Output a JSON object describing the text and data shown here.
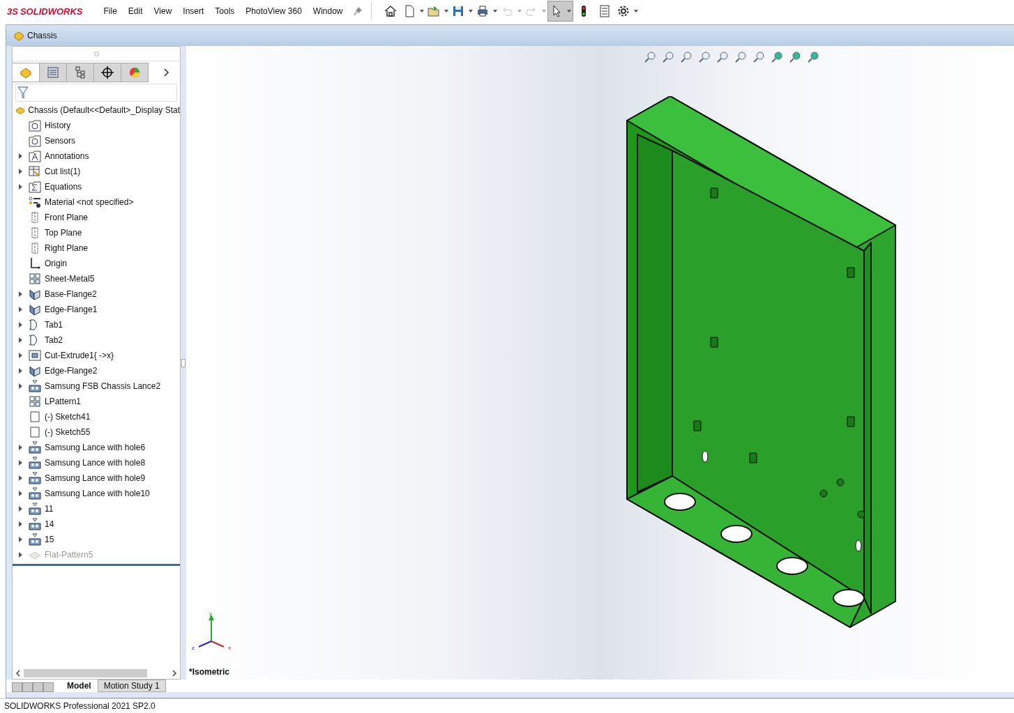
{
  "app": {
    "logo_mark": "3S",
    "logo_text": "SOLIDWORKS"
  },
  "menu": [
    "File",
    "Edit",
    "View",
    "Insert",
    "Tools",
    "PhotoView 360",
    "Window"
  ],
  "toolbar": [
    {
      "kind": "home",
      "dropdown": false,
      "selected": false,
      "disabled": false
    },
    {
      "kind": "new",
      "dropdown": true,
      "selected": false,
      "disabled": false
    },
    {
      "kind": "open",
      "dropdown": true,
      "selected": false,
      "disabled": false
    },
    {
      "kind": "save",
      "dropdown": true,
      "selected": false,
      "disabled": false
    },
    {
      "kind": "print",
      "dropdown": true,
      "selected": false,
      "disabled": false
    },
    {
      "kind": "undo",
      "dropdown": true,
      "selected": false,
      "disabled": true
    },
    {
      "kind": "redo",
      "dropdown": true,
      "selected": false,
      "disabled": true
    },
    {
      "kind": "select",
      "dropdown": true,
      "selected": true,
      "disabled": false
    },
    {
      "kind": "traffic",
      "dropdown": false,
      "selected": false,
      "disabled": false
    },
    {
      "kind": "options",
      "dropdown": false,
      "selected": false,
      "disabled": false
    },
    {
      "kind": "gear",
      "dropdown": true,
      "selected": false,
      "disabled": false
    }
  ],
  "document": {
    "title": "Chassis"
  },
  "panel_tabs": [
    {
      "kind": "feature",
      "selected": true
    },
    {
      "kind": "property",
      "selected": false
    },
    {
      "kind": "config",
      "selected": false
    },
    {
      "kind": "dim",
      "selected": false
    },
    {
      "kind": "display",
      "selected": false
    }
  ],
  "tree_root": "Chassis  (Default<<Default>_Display Stat",
  "tree": [
    {
      "label": "History",
      "kind": "history",
      "expandable": false,
      "suppressed": false
    },
    {
      "label": "Sensors",
      "kind": "sensors",
      "expandable": false,
      "suppressed": false
    },
    {
      "label": "Annotations",
      "kind": "annotations",
      "expandable": true,
      "suppressed": false
    },
    {
      "label": "Cut list(1)",
      "kind": "cutlist",
      "expandable": true,
      "suppressed": false
    },
    {
      "label": "Equations",
      "kind": "equations",
      "expandable": true,
      "suppressed": false
    },
    {
      "label": "Material <not specified>",
      "kind": "material",
      "expandable": false,
      "suppressed": false
    },
    {
      "label": "Front Plane",
      "kind": "plane",
      "expandable": false,
      "suppressed": false
    },
    {
      "label": "Top Plane",
      "kind": "plane",
      "expandable": false,
      "suppressed": false
    },
    {
      "label": "Right Plane",
      "kind": "plane",
      "expandable": false,
      "suppressed": false
    },
    {
      "label": "Origin",
      "kind": "origin",
      "expandable": false,
      "suppressed": false
    },
    {
      "label": "Sheet-Metal5",
      "kind": "sheetmetal",
      "expandable": false,
      "suppressed": false
    },
    {
      "label": "Base-Flange2",
      "kind": "flange",
      "expandable": true,
      "suppressed": false
    },
    {
      "label": "Edge-Flange1",
      "kind": "flange",
      "expandable": true,
      "suppressed": false
    },
    {
      "label": "Tab1",
      "kind": "tab",
      "expandable": true,
      "suppressed": false
    },
    {
      "label": "Tab2",
      "kind": "tab",
      "expandable": true,
      "suppressed": false
    },
    {
      "label": "Cut-Extrude1{ ->x}",
      "kind": "cut",
      "expandable": true,
      "suppressed": false
    },
    {
      "label": "Edge-Flange2",
      "kind": "flange",
      "expandable": true,
      "suppressed": false
    },
    {
      "label": "Samsung FSB Chassis Lance2",
      "kind": "lance",
      "expandable": true,
      "suppressed": false
    },
    {
      "label": "LPattern1",
      "kind": "pattern",
      "expandable": false,
      "suppressed": false
    },
    {
      "label": "(-) Sketch41",
      "kind": "sketch",
      "expandable": false,
      "suppressed": false
    },
    {
      "label": "(-) Sketch55",
      "kind": "sketch",
      "expandable": false,
      "suppressed": false
    },
    {
      "label": "Samsung Lance with hole6",
      "kind": "lance",
      "expandable": true,
      "suppressed": false
    },
    {
      "label": "Samsung Lance with hole8",
      "kind": "lance",
      "expandable": true,
      "suppressed": false
    },
    {
      "label": "Samsung Lance with hole9",
      "kind": "lance",
      "expandable": true,
      "suppressed": false
    },
    {
      "label": "Samsung Lance with hole10",
      "kind": "lance",
      "expandable": true,
      "suppressed": false
    },
    {
      "label": "11",
      "kind": "lance",
      "expandable": true,
      "suppressed": false
    },
    {
      "label": "14",
      "kind": "lance",
      "expandable": true,
      "suppressed": false
    },
    {
      "label": "15",
      "kind": "lance",
      "expandable": true,
      "suppressed": false
    },
    {
      "label": "Flat-Pattern5",
      "kind": "flatpattern",
      "expandable": true,
      "suppressed": true
    }
  ],
  "triad": {
    "x": "x",
    "y": "y",
    "z": "z"
  },
  "view_name": "*Isometric",
  "bottom_tabs": [
    {
      "label": "Model",
      "selected": true
    },
    {
      "label": "Motion Study 1",
      "selected": false
    }
  ],
  "status_bar": "SOLIDWORKS Professional 2021 SP2.0"
}
